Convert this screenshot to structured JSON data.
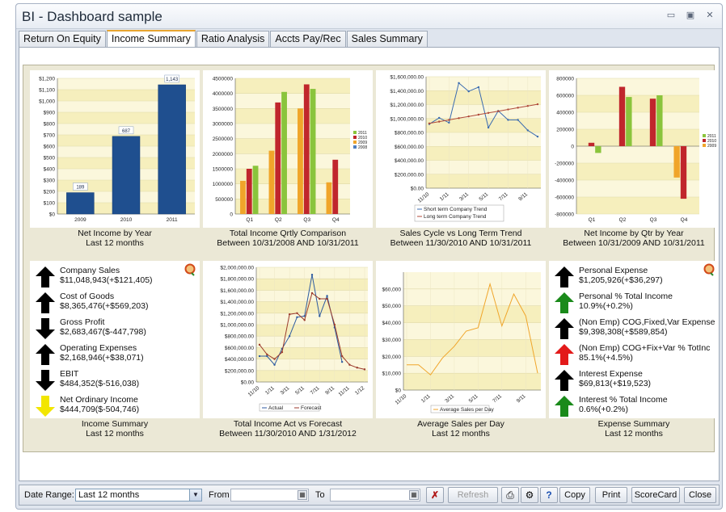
{
  "window": {
    "title": "BI - Dashboard sample"
  },
  "window_controls": {
    "minimize": "▭",
    "maximize": "▣",
    "close": "✕"
  },
  "tabs": [
    {
      "label": "Return On Equity",
      "active": false
    },
    {
      "label": "Income Summary",
      "active": true
    },
    {
      "label": "Ratio Analysis",
      "active": false
    },
    {
      "label": "Accts Pay/Rec",
      "active": false
    },
    {
      "label": "Sales Summary",
      "active": false
    }
  ],
  "panels": {
    "p1": {
      "line1": "Net Income by Year",
      "line2": "Last 12 months"
    },
    "p2": {
      "line1": "Total Income Qrtly Comparison",
      "line2": "Between 10/31/2008 AND 10/31/2011"
    },
    "p3": {
      "line1": "Sales Cycle vs Long Term Trend",
      "line2": "Between 11/30/2010 AND 10/31/2011"
    },
    "p4": {
      "line1": "Net Income by Qtr by Year",
      "line2": "Between 10/31/2009 AND 10/31/2011"
    },
    "p5": {
      "line1": "Income Summary",
      "line2": "Last 12 months"
    },
    "p6": {
      "line1": "Total Income Act vs Forecast",
      "line2": "Between 11/30/2010 AND 1/31/2012"
    },
    "p7": {
      "line1": "Average Sales per Day",
      "line2": "Last 12 months"
    },
    "p8": {
      "line1": "Expense Summary",
      "line2": "Last 12 months"
    }
  },
  "income_summary": [
    {
      "name": "Company Sales",
      "value": "$11,048,943(+$121,405)",
      "direction": "up",
      "color": "#000000"
    },
    {
      "name": "Cost of Goods",
      "value": "$8,365,476(+$569,203)",
      "direction": "up",
      "color": "#000000"
    },
    {
      "name": "Gross Profit",
      "value": "$2,683,467($-447,798)",
      "direction": "down",
      "color": "#000000"
    },
    {
      "name": "Operating Expenses",
      "value": "$2,168,946(+$38,071)",
      "direction": "up",
      "color": "#000000"
    },
    {
      "name": "EBIT",
      "value": "$484,352($-516,038)",
      "direction": "down",
      "color": "#000000"
    },
    {
      "name": "Net Ordinary Income",
      "value": "$444,709($-504,746)",
      "direction": "down",
      "color": "#f2e600"
    }
  ],
  "expense_summary": [
    {
      "name": "Personal Expense",
      "value": "$1,205,926(+$36,297)",
      "direction": "up",
      "color": "#000000"
    },
    {
      "name": "Personal % Total Income",
      "value": "10.9%(+0.2%)",
      "direction": "up",
      "color": "#1a8a1a"
    },
    {
      "name": "(Non Emp) COG,Fixed,Var Expense",
      "value": "$9,398,308(+$589,854)",
      "direction": "up",
      "color": "#000000"
    },
    {
      "name": "(Non Emp) COG+Fix+Var % TotInc",
      "value": "85.1%(+4.5%)",
      "direction": "up",
      "color": "#e31a1a"
    },
    {
      "name": "Interest Expense",
      "value": "$69,813(+$19,523)",
      "direction": "up",
      "color": "#000000"
    },
    {
      "name": "Interest % Total Income",
      "value": "0.6%(+0.2%)",
      "direction": "up",
      "color": "#1a8a1a"
    }
  ],
  "colors": {
    "accent_tab": "#e8a52f",
    "bar_blue": "#1f4f8f",
    "y2011": "#8ac43c",
    "y2010": "#c0262c",
    "y2009": "#f0a52a",
    "y2008": "#4f7fbf",
    "forecast": "#9b3a2c",
    "actual": "#2c5aa0"
  },
  "chart_data": [
    {
      "type": "bar",
      "title": "Net Income by Year",
      "categories": [
        "2009",
        "2010",
        "2011"
      ],
      "values": [
        189,
        687,
        1143
      ],
      "data_labels": [
        "189",
        "687",
        "1,143"
      ],
      "yticks": [
        "$0",
        "$100",
        "$200",
        "$300",
        "$400",
        "$500",
        "$600",
        "$700",
        "$800",
        "$900",
        "$1,000",
        "$1,100",
        "$1,200"
      ],
      "ylim": [
        0,
        1200
      ],
      "grid": true
    },
    {
      "type": "bar",
      "title": "Total Income Qrtly Comparison",
      "categories": [
        "Q1",
        "Q2",
        "Q3",
        "Q4"
      ],
      "series": [
        {
          "name": "2009",
          "values": [
            1100000,
            2100000,
            3500000,
            1050000
          ]
        },
        {
          "name": "2010",
          "values": [
            1500000,
            3700000,
            4300000,
            1800000
          ]
        },
        {
          "name": "2011",
          "values": [
            1600000,
            4050000,
            4150000,
            null
          ]
        }
      ],
      "legend": [
        "2011",
        "2010",
        "2009",
        "2008"
      ],
      "yticks": [
        "0",
        "500000",
        "1000000",
        "1500000",
        "2000000",
        "2500000",
        "3000000",
        "3500000",
        "4000000",
        "4500000"
      ],
      "ylim": [
        0,
        4500000
      ],
      "legend_position": "right"
    },
    {
      "type": "line",
      "title": "Sales Cycle vs Long Term Trend",
      "x": [
        "11/10",
        "12/10",
        "1/11",
        "2/11",
        "3/11",
        "4/11",
        "5/11",
        "6/11",
        "7/11",
        "8/11",
        "9/11",
        "10/11"
      ],
      "xticks": [
        "11/10",
        "1/11",
        "3/11",
        "5/11",
        "7/11",
        "9/11"
      ],
      "series": [
        {
          "name": "Short term Company Trend",
          "values": [
            920000,
            1010000,
            940000,
            1510000,
            1390000,
            1450000,
            870000,
            1110000,
            980000,
            980000,
            830000,
            740000
          ]
        },
        {
          "name": "Long term Company Trend",
          "values": [
            930000,
            955000,
            980000,
            1005000,
            1030000,
            1055000,
            1080000,
            1105000,
            1130000,
            1155000,
            1180000,
            1205000
          ]
        }
      ],
      "yticks": [
        "$0.00",
        "$200,000.00",
        "$400,000.00",
        "$600,000.00",
        "$800,000.00",
        "$1,000,000.00",
        "$1,200,000.00",
        "$1,400,000.00",
        "$1,600,000.00"
      ],
      "ylim": [
        0,
        1600000
      ],
      "legend_position": "bottom"
    },
    {
      "type": "bar",
      "title": "Net Income by Qtr by Year",
      "categories": [
        "Q1",
        "Q2",
        "Q3",
        "Q4"
      ],
      "series": [
        {
          "name": "2009",
          "values": [
            null,
            null,
            null,
            -370000
          ]
        },
        {
          "name": "2010",
          "values": [
            40000,
            700000,
            560000,
            -620000
          ]
        },
        {
          "name": "2011",
          "values": [
            -80000,
            580000,
            600000,
            null
          ]
        }
      ],
      "legend": [
        "2011",
        "2010",
        "2009"
      ],
      "yticks": [
        "-800000",
        "-600000",
        "-400000",
        "-200000",
        "0",
        "200000",
        "400000",
        "600000",
        "800000"
      ],
      "ylim": [
        -800000,
        800000
      ],
      "legend_position": "right"
    },
    {
      "type": "line",
      "title": "Total Income Act vs Forecast",
      "x": [
        "11/10",
        "12/10",
        "1/11",
        "2/11",
        "3/11",
        "4/11",
        "5/11",
        "6/11",
        "7/11",
        "8/11",
        "9/11",
        "10/11",
        "11/11",
        "12/11",
        "1/12"
      ],
      "xticks": [
        "11/10",
        "1/11",
        "3/11",
        "5/11",
        "7/11",
        "9/11",
        "11/11",
        "1/12"
      ],
      "series": [
        {
          "name": "Actual",
          "values": [
            450000,
            450000,
            300000,
            580000,
            800000,
            1130000,
            1150000,
            1870000,
            1150000,
            1500000,
            950000,
            350000,
            null,
            null,
            null
          ]
        },
        {
          "name": "Forecast",
          "values": [
            650000,
            480000,
            400000,
            520000,
            1180000,
            1200000,
            1080000,
            1550000,
            1450000,
            1450000,
            1000000,
            450000,
            300000,
            250000,
            220000
          ]
        }
      ],
      "yticks": [
        "$0.00",
        "$200,000.00",
        "$400,000.00",
        "$600,000.00",
        "$800,000.00",
        "$1,000,000.00",
        "$1,200,000.00",
        "$1,400,000.00",
        "$1,600,000.00",
        "$1,800,000.00",
        "$2,000,000.00"
      ],
      "ylim": [
        0,
        2000000
      ],
      "legend_position": "bottom"
    },
    {
      "type": "line",
      "title": "Average Sales per Day",
      "x": [
        "11/10",
        "12/10",
        "1/11",
        "2/11",
        "3/11",
        "4/11",
        "5/11",
        "6/11",
        "7/11",
        "8/11",
        "9/11",
        "10/11"
      ],
      "xticks": [
        "11/10",
        "1/11",
        "3/11",
        "5/11",
        "7/11",
        "9/11"
      ],
      "series": [
        {
          "name": "Average Sales per Day",
          "values": [
            15000,
            15000,
            9000,
            19000,
            26000,
            35000,
            37000,
            63000,
            38000,
            57000,
            44000,
            10000
          ]
        }
      ],
      "yticks": [
        "$0",
        "$10,000",
        "$20,000",
        "$30,000",
        "$40,000",
        "$50,000",
        "$60,000"
      ],
      "ylim": [
        0,
        70000
      ],
      "legend_position": "bottom"
    }
  ],
  "bottombar": {
    "date_range_label": "Date Range:",
    "date_range_value": "Last 12 months",
    "from_label": "From",
    "to_label": "To",
    "refresh_label": "Refresh",
    "copy_label": "Copy",
    "print_label": "Print",
    "scorecard_label": "ScoreCard",
    "close_label": "Close",
    "help_label": "?"
  }
}
